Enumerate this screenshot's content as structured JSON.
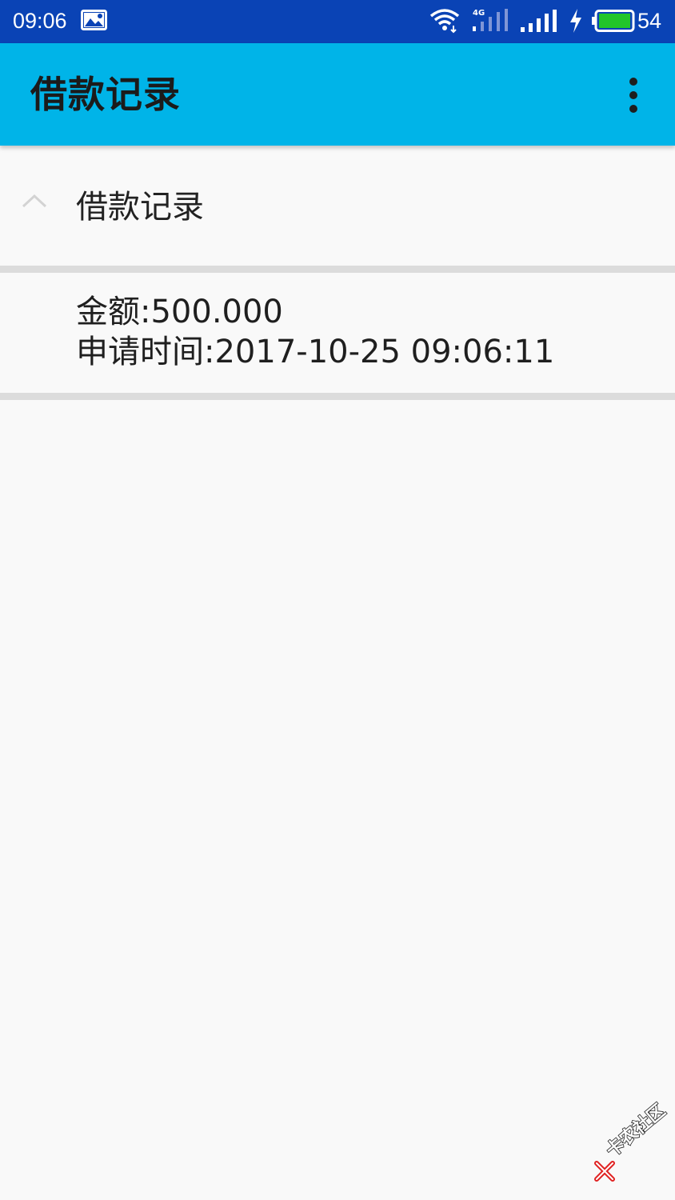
{
  "status_bar": {
    "time": "09:06",
    "network_label": "4G",
    "battery_level": "54",
    "battery_color": "#22c52a",
    "icons": [
      "photo-icon",
      "wifi-icon",
      "4g-signal-icon",
      "signal-icon",
      "charging-icon",
      "battery-icon"
    ]
  },
  "app_bar": {
    "title": "借款记录",
    "background": "#00b4e8",
    "menu_icon": "more-vert-icon"
  },
  "section": {
    "title": "借款记录",
    "expanded": true,
    "icon": "chevron-up-icon"
  },
  "records": [
    {
      "amount_line": "金额:500.000",
      "time_line": "申请时间:2017-10-25 09:06:11"
    }
  ],
  "watermark": {
    "text": "卡农社区"
  },
  "colors": {
    "status_bar": "#0a43b5",
    "app_bar": "#00b4e8",
    "divider": "#dcdcdc",
    "background": "#f9f9f9"
  }
}
